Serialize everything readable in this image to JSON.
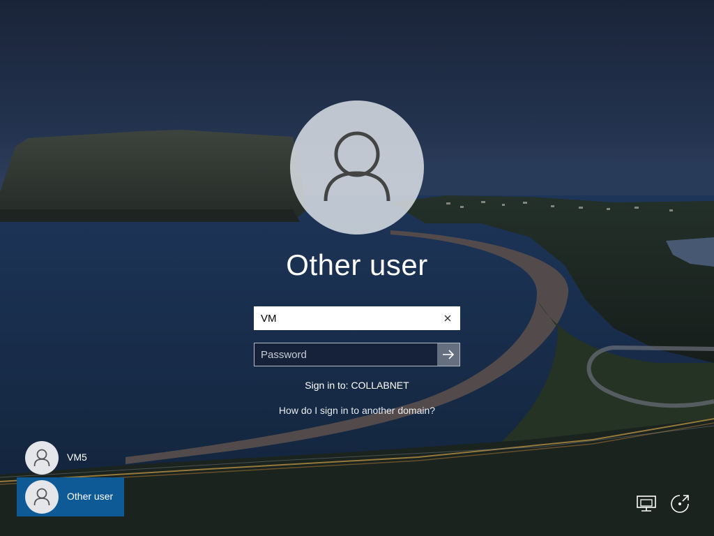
{
  "login": {
    "user_title": "Other user",
    "username_value": "VM",
    "password_placeholder": "Password",
    "sign_in_to": "Sign in to: COLLABNET",
    "domain_help_link": "How do I sign in to another domain?"
  },
  "user_list": [
    {
      "name": "VM5",
      "selected": false
    },
    {
      "name": "Other user",
      "selected": true
    }
  ],
  "icons": {
    "avatar": "user-avatar-icon",
    "clear": "clear-x-icon",
    "submit": "arrow-right-icon",
    "network": "network-icon",
    "power": "power-icon",
    "ease_of_access": "ease-of-access-icon"
  },
  "colors": {
    "selected_tile": "#0e5a96",
    "text": "#ffffff",
    "sky_top": "#1f2c44",
    "water": "#1b3352"
  }
}
